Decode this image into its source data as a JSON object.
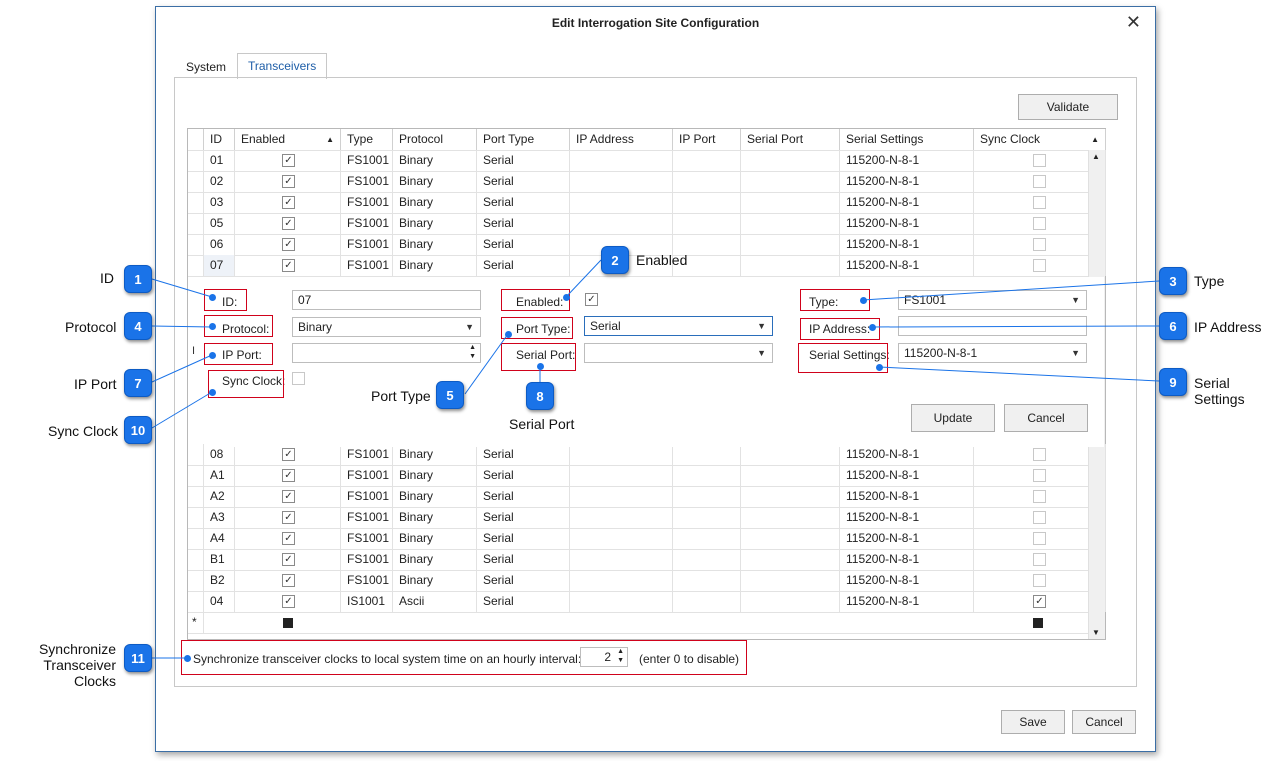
{
  "dialog": {
    "title": "Edit Interrogation Site Configuration",
    "close_glyph": "✕",
    "tabs": [
      "System",
      "Transceivers"
    ],
    "validate_label": "Validate",
    "save_label": "Save",
    "cancel_label": "Cancel"
  },
  "grid": {
    "columns": [
      "ID",
      "Enabled",
      "Type",
      "Protocol",
      "Port Type",
      "IP Address",
      "IP Port",
      "Serial Port",
      "Serial Settings",
      "Sync Clock"
    ],
    "sort_glyph": "▲",
    "rows_top": [
      {
        "id": "01",
        "enabled": true,
        "type": "FS1001",
        "protocol": "Binary",
        "port_type": "Serial",
        "serial_settings": "115200-N-8-1",
        "sync": false
      },
      {
        "id": "02",
        "enabled": true,
        "type": "FS1001",
        "protocol": "Binary",
        "port_type": "Serial",
        "serial_settings": "115200-N-8-1",
        "sync": false
      },
      {
        "id": "03",
        "enabled": true,
        "type": "FS1001",
        "protocol": "Binary",
        "port_type": "Serial",
        "serial_settings": "115200-N-8-1",
        "sync": false
      },
      {
        "id": "05",
        "enabled": true,
        "type": "FS1001",
        "protocol": "Binary",
        "port_type": "Serial",
        "serial_settings": "115200-N-8-1",
        "sync": false
      },
      {
        "id": "06",
        "enabled": true,
        "type": "FS1001",
        "protocol": "Binary",
        "port_type": "Serial",
        "serial_settings": "115200-N-8-1",
        "sync": false
      },
      {
        "id": "07",
        "enabled": true,
        "type": "FS1001",
        "protocol": "Binary",
        "port_type": "Serial",
        "serial_settings": "115200-N-8-1",
        "sync": false
      }
    ],
    "rows_bottom": [
      {
        "id": "08",
        "enabled": true,
        "type": "FS1001",
        "protocol": "Binary",
        "port_type": "Serial",
        "serial_settings": "115200-N-8-1",
        "sync": false
      },
      {
        "id": "A1",
        "enabled": true,
        "type": "FS1001",
        "protocol": "Binary",
        "port_type": "Serial",
        "serial_settings": "115200-N-8-1",
        "sync": false
      },
      {
        "id": "A2",
        "enabled": true,
        "type": "FS1001",
        "protocol": "Binary",
        "port_type": "Serial",
        "serial_settings": "115200-N-8-1",
        "sync": false
      },
      {
        "id": "A3",
        "enabled": true,
        "type": "FS1001",
        "protocol": "Binary",
        "port_type": "Serial",
        "serial_settings": "115200-N-8-1",
        "sync": false
      },
      {
        "id": "A4",
        "enabled": true,
        "type": "FS1001",
        "protocol": "Binary",
        "port_type": "Serial",
        "serial_settings": "115200-N-8-1",
        "sync": false
      },
      {
        "id": "B1",
        "enabled": true,
        "type": "FS1001",
        "protocol": "Binary",
        "port_type": "Serial",
        "serial_settings": "115200-N-8-1",
        "sync": false
      },
      {
        "id": "B2",
        "enabled": true,
        "type": "FS1001",
        "protocol": "Binary",
        "port_type": "Serial",
        "serial_settings": "115200-N-8-1",
        "sync": false
      },
      {
        "id": "04",
        "enabled": true,
        "type": "IS1001",
        "protocol": "Ascii",
        "port_type": "Serial",
        "serial_settings": "115200-N-8-1",
        "sync": true
      }
    ],
    "new_row_glyph": "*"
  },
  "editor": {
    "id_label": "ID:",
    "id_value": "07",
    "enabled_label": "Enabled:",
    "type_label": "Type:",
    "type_value": "FS1001",
    "protocol_label": "Protocol:",
    "protocol_value": "Binary",
    "port_type_label": "Port Type:",
    "port_type_value": "Serial",
    "ip_address_label": "IP Address:",
    "ip_port_label": "IP Port:",
    "serial_port_label": "Serial Port:",
    "serial_settings_label": "Serial Settings:",
    "serial_settings_value": "115200-N-8-1",
    "sync_clock_label": "Sync Clock:",
    "update_label": "Update",
    "cancel_label": "Cancel"
  },
  "sync_interval": {
    "label": "Synchronize transceiver clocks to local system time on an hourly interval:",
    "value": "2",
    "hint": "(enter 0 to disable)"
  },
  "callouts": [
    {
      "num": "1",
      "text": "ID"
    },
    {
      "num": "2",
      "text": "Enabled"
    },
    {
      "num": "3",
      "text": "Type"
    },
    {
      "num": "4",
      "text": "Protocol"
    },
    {
      "num": "5",
      "text": "Port Type"
    },
    {
      "num": "6",
      "text": "IP Address"
    },
    {
      "num": "7",
      "text": "IP Port"
    },
    {
      "num": "8",
      "text": "Serial Port"
    },
    {
      "num": "9",
      "text": "Serial Settings"
    },
    {
      "num": "10",
      "text": "Sync Clock"
    },
    {
      "num": "11",
      "text_line1": "Synchronize",
      "text_line2": "Transceiver Clocks"
    }
  ],
  "colors": {
    "accent": "#1a73e8",
    "highlight": "#d0021b",
    "tab_active": "#1e5ea8"
  }
}
